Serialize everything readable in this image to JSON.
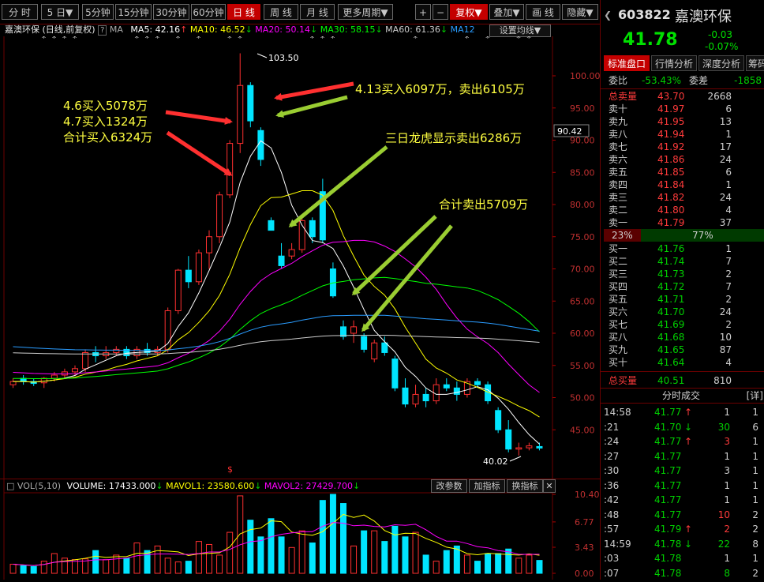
{
  "toolbar": {
    "periods": [
      "分 时",
      "5 日",
      "5分钟",
      "15分钟",
      "30分钟",
      "60分钟",
      "日 线",
      "周 线",
      "月 线",
      "更多周期"
    ],
    "active_period": "日 线",
    "right_buttons": [
      "+",
      "−",
      "复权",
      "叠加",
      "画 线",
      "隐藏"
    ]
  },
  "ma_bar": {
    "stock": "嘉澳环保",
    "mode": "(日线,前复权)",
    "ma_label": "MA",
    "ma5": "MA5: 42.16",
    "ma10": "MA10: 46.52",
    "ma20": "MA20: 50.14",
    "ma30": "MA30: 58.15",
    "ma60": "MA60: 61.36",
    "ma120": "MA12",
    "settings": "设置均线"
  },
  "chart": {
    "price_ticks": [
      "100.00",
      "95.00",
      "90.00",
      "85.00",
      "80.00",
      "75.00",
      "70.00",
      "65.00",
      "60.00",
      "55.00",
      "50.00",
      "45.00"
    ],
    "current_price_tag": "90.42",
    "high_label": "103.50",
    "low_label": "40.02",
    "annotations": {
      "buy_lines": [
        "4.6买入5078万",
        "4.7买入1324万",
        "合计买入6324万"
      ],
      "a413": "4.13买入6097万，卖出6105万",
      "longhu": "三日龙虎显示卖出6286万",
      "sell": "合计卖出5709万"
    },
    "colors": {
      "up": "#ff3030",
      "down": "#00e5ff",
      "ma5": "#ffffff",
      "ma10": "#ffff00",
      "ma20": "#ff00ff",
      "ma30": "#00ff00",
      "ma60": "#2a9cff",
      "ma120": "#cccccc",
      "arrow_red": "#ff3030",
      "arrow_green": "#9acd32"
    }
  },
  "volume": {
    "title": "VOL(5,10)",
    "volume": "VOLUME: 17433.000",
    "mavol1": "MAVOL1: 23580.600",
    "mavol2": "MAVOL2: 27429.700",
    "btn_params": "改参数",
    "btn_add": "加指标",
    "btn_switch": "换指标",
    "ticks": [
      "10.40",
      "6.77",
      "3.43",
      "0.00"
    ]
  },
  "quote": {
    "code": "603822",
    "name": "嘉澳环保",
    "price": "41.78",
    "change": "-0.03",
    "change_pct": "-0.07%",
    "tabs": [
      "标准盘口",
      "行情分析",
      "深度分析",
      "筹码"
    ],
    "weibi_label": "委比",
    "weibi": "-53.43%",
    "weicha_label": "委差",
    "weicha": "-1858",
    "total_sell_label": "总卖量",
    "total_sell_price": "43.70",
    "total_sell_vol": "2668",
    "asks": [
      {
        "label": "卖十",
        "price": "41.97",
        "vol": "6"
      },
      {
        "label": "卖九",
        "price": "41.95",
        "vol": "13"
      },
      {
        "label": "卖八",
        "price": "41.94",
        "vol": "1"
      },
      {
        "label": "卖七",
        "price": "41.92",
        "vol": "17"
      },
      {
        "label": "卖六",
        "price": "41.86",
        "vol": "24"
      },
      {
        "label": "卖五",
        "price": "41.85",
        "vol": "6"
      },
      {
        "label": "卖四",
        "price": "41.84",
        "vol": "1"
      },
      {
        "label": "卖三",
        "price": "41.82",
        "vol": "24"
      },
      {
        "label": "卖二",
        "price": "41.80",
        "vol": "4"
      },
      {
        "label": "卖一",
        "price": "41.79",
        "vol": "37"
      }
    ],
    "ratio_left": "23%",
    "ratio_right": "77%",
    "ratio_fraction": 0.23,
    "bids": [
      {
        "label": "买一",
        "price": "41.76",
        "vol": "1"
      },
      {
        "label": "买二",
        "price": "41.74",
        "vol": "7"
      },
      {
        "label": "买三",
        "price": "41.73",
        "vol": "2"
      },
      {
        "label": "买四",
        "price": "41.72",
        "vol": "7"
      },
      {
        "label": "买五",
        "price": "41.71",
        "vol": "2"
      },
      {
        "label": "买六",
        "price": "41.70",
        "vol": "24"
      },
      {
        "label": "买七",
        "price": "41.69",
        "vol": "2"
      },
      {
        "label": "买八",
        "price": "41.68",
        "vol": "10"
      },
      {
        "label": "买九",
        "price": "41.65",
        "vol": "87"
      },
      {
        "label": "买十",
        "price": "41.64",
        "vol": "4"
      }
    ],
    "total_buy_label": "总买量",
    "total_buy_price": "40.51",
    "total_buy_vol": "810",
    "ticks_title": "分时成交",
    "ticks_detail": "[详]",
    "trades": [
      {
        "time": "14:58",
        "price": "41.77",
        "dir": "up",
        "vol": "1",
        "n": "1"
      },
      {
        "time": ":21",
        "price": "41.70",
        "dir": "down",
        "vol": "30",
        "n": "6"
      },
      {
        "time": ":24",
        "price": "41.77",
        "dir": "up",
        "vol": "3",
        "n": "1"
      },
      {
        "time": ":27",
        "price": "41.77",
        "dir": "",
        "vol": "1",
        "n": "1"
      },
      {
        "time": ":30",
        "price": "41.77",
        "dir": "",
        "vol": "3",
        "n": "1"
      },
      {
        "time": ":36",
        "price": "41.77",
        "dir": "",
        "vol": "1",
        "n": "1"
      },
      {
        "time": ":42",
        "price": "41.77",
        "dir": "",
        "vol": "1",
        "n": "1"
      },
      {
        "time": ":48",
        "price": "41.77",
        "dir": "",
        "vol": "10",
        "n": "2"
      },
      {
        "time": ":57",
        "price": "41.79",
        "dir": "up",
        "vol": "2",
        "n": "2"
      },
      {
        "time": "14:59",
        "price": "41.78",
        "dir": "down",
        "vol": "22",
        "n": "8"
      },
      {
        "time": ":03",
        "price": "41.78",
        "dir": "",
        "vol": "1",
        "n": "1"
      },
      {
        "time": ":07",
        "price": "41.78",
        "dir": "",
        "vol": "8",
        "n": "2"
      }
    ]
  }
}
